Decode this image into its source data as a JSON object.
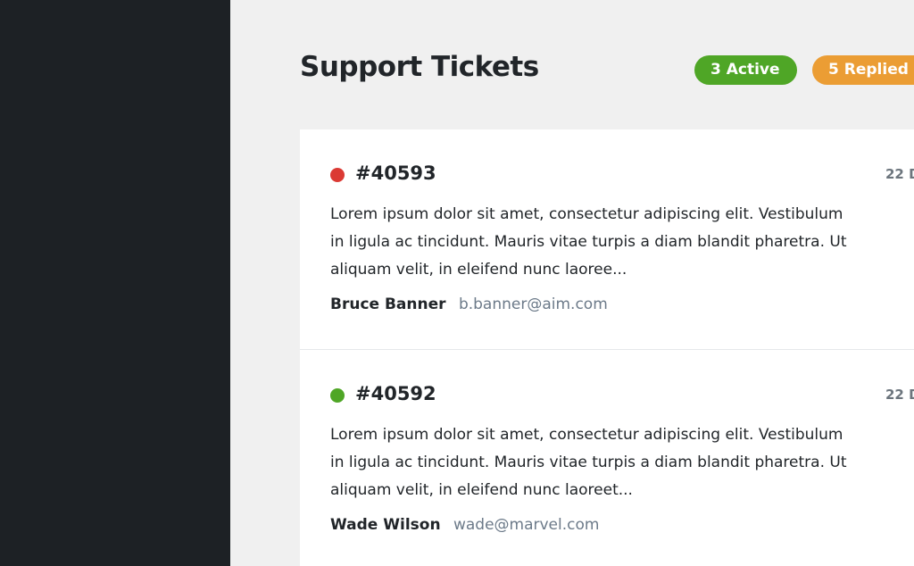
{
  "header": {
    "title": "Support Tickets",
    "badges": {
      "active": "3 Active",
      "replied": "5 Replied"
    }
  },
  "colors": {
    "sidebar": "#1d2125",
    "active_badge": "#4fa626",
    "replied_badge": "#eb9d34",
    "status_red": "#db3a34",
    "status_green": "#4fa626"
  },
  "tickets": [
    {
      "id": "#40593",
      "status_color": "red",
      "date": "22 D",
      "body_lines": [
        "Lorem ipsum dolor sit amet, consectetur adipiscing elit. Vestibulum",
        "in ligula ac tincidunt. Mauris vitae turpis a diam blandit pharetra. Ut",
        "aliquam velit, in eleifend nunc laoree..."
      ],
      "author_name": "Bruce Banner",
      "author_email": "b.banner@aim.com"
    },
    {
      "id": "#40592",
      "status_color": "green",
      "date": "22 D",
      "body_lines": [
        "Lorem ipsum dolor sit amet, consectetur adipiscing elit. Vestibulum",
        "in ligula ac tincidunt. Mauris vitae turpis a diam blandit pharetra. Ut",
        "aliquam velit, in eleifend nunc laoreet..."
      ],
      "author_name": "Wade Wilson",
      "author_email": "wade@marvel.com"
    }
  ]
}
